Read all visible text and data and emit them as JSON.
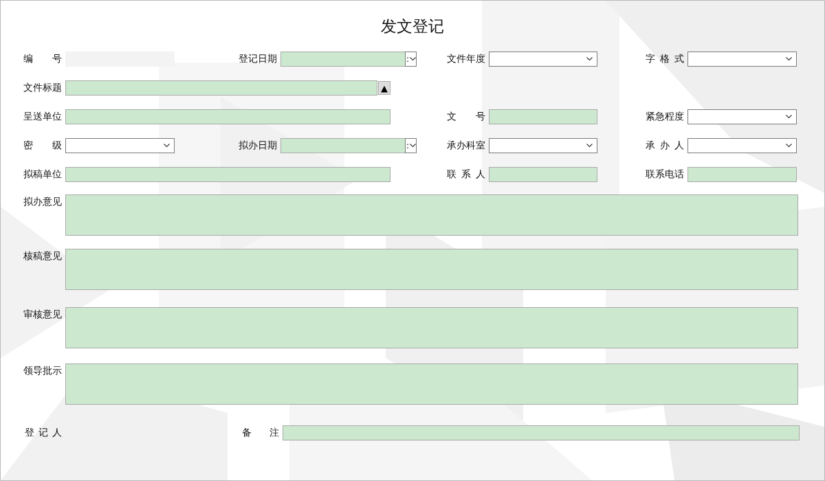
{
  "title": "发文登记",
  "rows": [
    [
      {
        "label": "编 号",
        "kind": "readonly"
      },
      {
        "label": "登记日期",
        "kind": "date",
        "picker": ":"
      },
      {
        "label": "文件年度",
        "kind": "combo"
      },
      {
        "label": "字 格 式",
        "kind": "combo"
      }
    ],
    [
      {
        "label": "文件标题",
        "kind": "wide-button",
        "button": "▲"
      }
    ],
    [
      {
        "label": "呈送单位",
        "kind": "wide"
      },
      {
        "label": "文 号",
        "kind": "text"
      },
      {
        "label": "紧急程度",
        "kind": "combo"
      }
    ],
    [
      {
        "label": "密 级",
        "kind": "combo"
      },
      {
        "label": "拟办日期",
        "kind": "date",
        "picker": ":"
      },
      {
        "label": "承办科室",
        "kind": "combo"
      },
      {
        "label": "承 办 人",
        "kind": "combo"
      }
    ],
    [
      {
        "label": "拟稿单位",
        "kind": "wide"
      },
      {
        "label": "联 系 人",
        "kind": "text"
      },
      {
        "label": "联系电话",
        "kind": "text"
      }
    ]
  ],
  "opinions": [
    {
      "label": "拟办意见"
    },
    {
      "label": "核稿意见"
    },
    {
      "label": "审核意见"
    },
    {
      "label": "领导批示"
    }
  ],
  "footer": [
    {
      "label": "登 记 人",
      "kind": "none"
    },
    {
      "label": "备 注",
      "kind": "text"
    }
  ]
}
